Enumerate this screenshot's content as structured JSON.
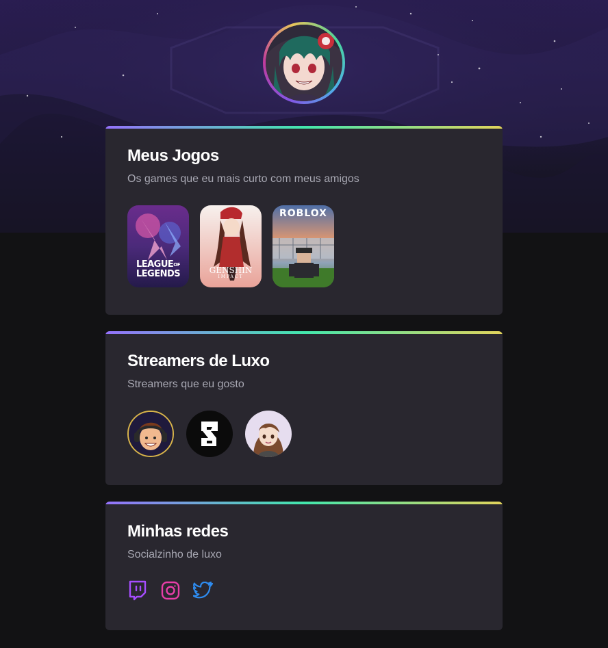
{
  "profile": {
    "avatar_icon": "anime-avatar-icon"
  },
  "games_card": {
    "title": "Meus Jogos",
    "subtitle": "Os games que eu mais curto com meus amigos",
    "games": [
      {
        "name": "League of Legends",
        "label_line1": "LEAGUE",
        "label_of": "OF",
        "label_line2": "LEGENDS"
      },
      {
        "name": "Genshin Impact",
        "label_line1": "GENSHIN",
        "label_line2": "IMPACT"
      },
      {
        "name": "Roblox",
        "label_line1": "ROBLOX"
      }
    ]
  },
  "streamers_card": {
    "title": "Streamers de Luxo",
    "subtitle": "Streamers que eu gosto",
    "streamers": [
      {
        "icon": "streamer-avatar-headset-icon"
      },
      {
        "icon": "streamer-avatar-logo-icon"
      },
      {
        "icon": "streamer-avatar-girl-icon"
      }
    ]
  },
  "socials_card": {
    "title": "Minhas redes",
    "subtitle": "Socialzinho de luxo",
    "links": [
      {
        "icon": "twitch-icon",
        "color": "#9146ff"
      },
      {
        "icon": "instagram-icon",
        "color": "#e1306c"
      },
      {
        "icon": "twitter-icon",
        "color": "#1d9bf0"
      }
    ]
  },
  "colors": {
    "background": "#121214",
    "card": "#29272f",
    "text": "#ffffff",
    "muted": "#a8a8b3",
    "gradient_start": "#9572fc",
    "gradient_mid": "#43e7ad",
    "gradient_end": "#e2d45c"
  }
}
